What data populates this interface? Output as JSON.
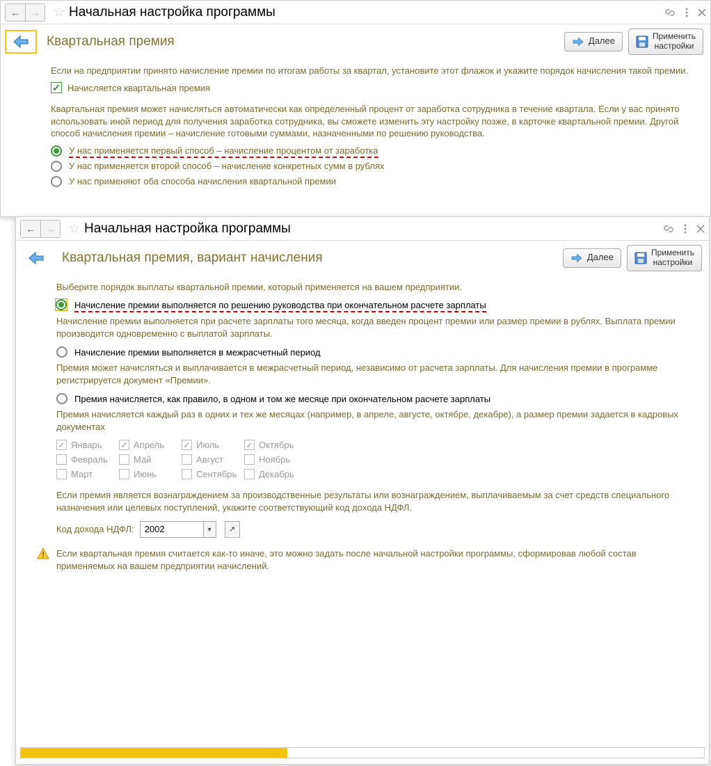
{
  "window1": {
    "title": "Начальная настройка программы",
    "section_title": "Квартальная премия",
    "btn_next": "Далее",
    "btn_apply_l1": "Применить",
    "btn_apply_l2": "настройки",
    "intro": "Если на предприятии принято начисление премии по итогам работы за квартал, установите этот флажок и укажите порядок начисления такой премии.",
    "checkbox_label": "Начисляется квартальная премия",
    "desc": "Квартальная премия может начисляться автоматически как определенный процент от заработка сотрудника в течение квартала. Если у вас принято использовать иной период для получения заработка сотрудника, вы сможете изменить эту настройку позже, в карточке квартальной премии. Другой способ начисления премии – начисление готовыми суммами, назначенными по решению руководства.",
    "opt1": "У нас применяется первый способ – начисление процентом от заработка",
    "opt2": "У нас применяется второй способ – начисление конкретных сумм в рублях",
    "opt3": "У нас применяют оба способа начисления квартальной премии"
  },
  "window2": {
    "title": "Начальная настройка программы",
    "section_title": "Квартальная премия,  вариант начисления",
    "btn_next": "Далее",
    "btn_apply_l1": "Применить",
    "btn_apply_l2": "настройки",
    "intro": "Выберите порядок выплаты квартальной премии, который применяется на вашем предприятии.",
    "optA": "Начисление премии выполняется по решению руководства при окончательном расчете зарплаты",
    "descA": "Начисление премии выполняется при расчете зарплаты того месяца, когда введен процент премии или размер премии в рублях. Выплата премии производится одновременно с выплатой зарплаты.",
    "optB": "Начисление премии выполняется в межрасчетный период",
    "descB": "Премия может начисляться и выплачивается в межрасчетный период, независимо от расчета зарплаты. Для начисления премии в программе регистрируется документ «Премии».",
    "optC": "Премия начисляется, как правило, в одном и том же месяце при окончательном расчете зарплаты",
    "descC": "Премия начисляется каждый раз в одних и тех же месяцах (например, в апреле, августе, октябре, декабре), а размер премии задается в кадровых документах",
    "months": {
      "jan": "Январь",
      "feb": "Февраль",
      "mar": "Март",
      "apr": "Апрель",
      "may": "Май",
      "jun": "Июнь",
      "jul": "Июль",
      "aug": "Август",
      "sep": "Сентябрь",
      "oct": "Октябрь",
      "nov": "Ноябрь",
      "dec": "Декабрь"
    },
    "ndfl_intro": "Если премия является вознаграждением за производственные результаты или вознаграждением, выплачиваемым за счет средств специального назначения или целевых поступлений, укажите соответствующий код дохода НДФЛ.",
    "ndfl_label": "Код дохода НДФЛ:",
    "ndfl_value": "2002",
    "warn": "Если квартальная премия считается как-то иначе, это можно задать после начальной настройки программы, сформировав любой состав применяемых на вашем предприятии начислений."
  }
}
